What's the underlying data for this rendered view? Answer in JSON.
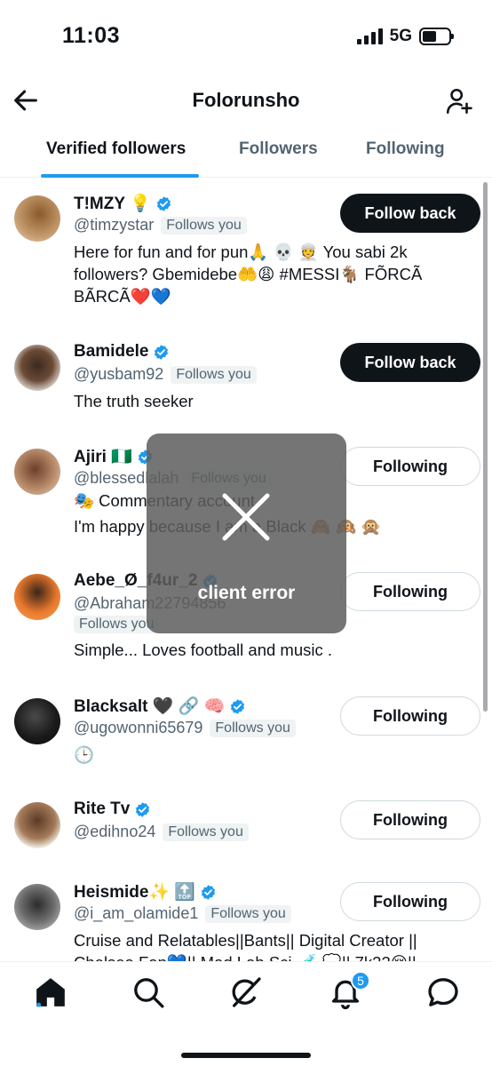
{
  "status": {
    "time": "11:03",
    "network": "5G"
  },
  "header": {
    "title": "Folorunsho"
  },
  "tabs": [
    "Verified followers",
    "Followers",
    "Following"
  ],
  "badge_text": "Follows you",
  "users": [
    {
      "name": "T!MZY 💡",
      "handle": "@timzystar",
      "bio": "Here for fun and for pun🙏 💀 👳 You sabi 2k followers? Gbemidebe🤲😩 #MESSI🐐 FÕRCÃ BÃRCÃ❤️💙",
      "button": "Follow back"
    },
    {
      "name": "Bamidele",
      "handle": "@yusbam92",
      "bio": "The truth seeker",
      "button": "Follow back"
    },
    {
      "name": "Ajiri 🇳🇬",
      "handle": "@blessedlalah",
      "bio": "🎭 Commentary account",
      "bio2": "I'm happy because I am a Black 🙈 🙉 🙊",
      "button": "Following"
    },
    {
      "name": "Aebe_Ø_f4ur_2",
      "handle": "@Abraham22794856",
      "bio": "Simple... Loves football and music .",
      "button": "Following"
    },
    {
      "name": "Blacksalt 🖤 🔗 🧠",
      "handle": "@ugowonni65679",
      "bio": "🕒",
      "button": "Following"
    },
    {
      "name": "Rite Tv",
      "handle": "@edihno24",
      "bio": "",
      "button": "Following"
    },
    {
      "name": "Heismide✨ 🔝",
      "handle": "@i_am_olamide1",
      "bio": "Cruise and Relatables||Bants|| Digital Creator ||",
      "bio2": "Chelsea Fan💙|| Mad Lab Sci 🧪 💭|| 7k22😪||",
      "button": "Following"
    }
  ],
  "error": {
    "text": "client error"
  },
  "nav": {
    "notifications_count": "5"
  },
  "colors": {
    "accent": "#1d9bf0",
    "text": "#0f1419",
    "muted": "#536471"
  },
  "icons": [
    "back-arrow-icon",
    "add-user-icon",
    "verified-icon",
    "close-icon",
    "home-icon",
    "search-icon",
    "grok-icon",
    "bell-icon",
    "mail-icon"
  ]
}
